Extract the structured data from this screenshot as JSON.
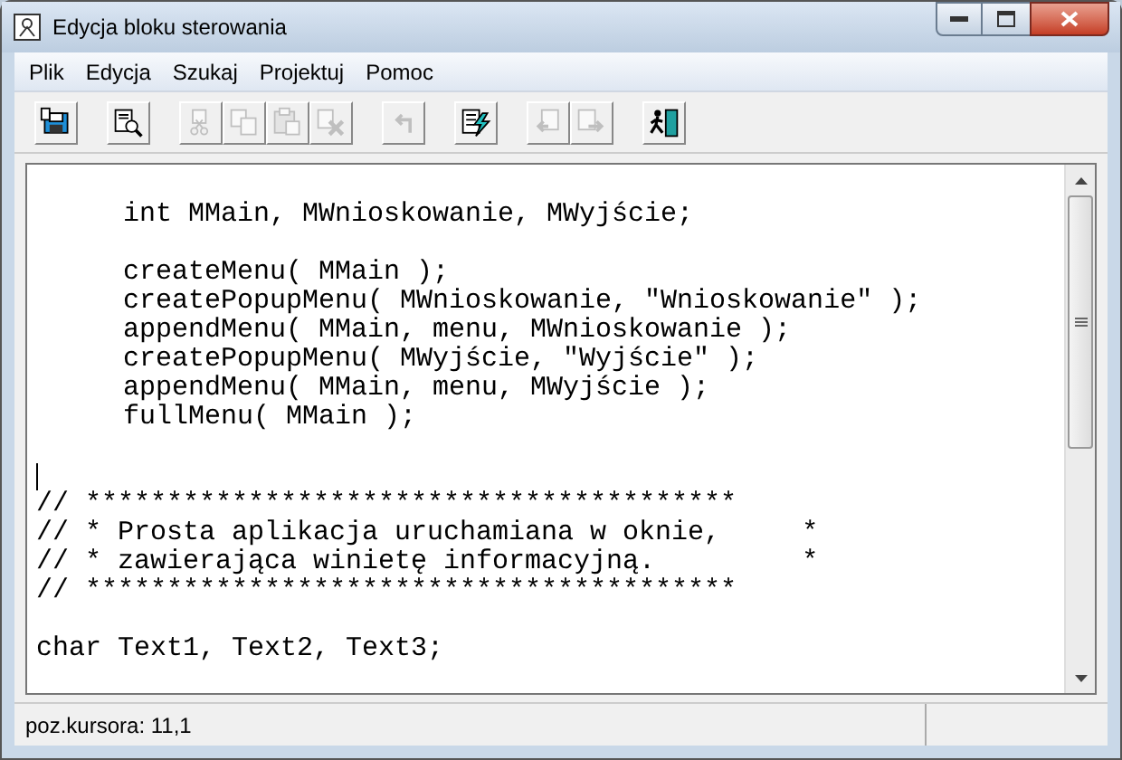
{
  "window": {
    "title": "Edycja bloku sterowania"
  },
  "menu": [
    {
      "label": "Plik"
    },
    {
      "label": "Edycja"
    },
    {
      "label": "Szukaj"
    },
    {
      "label": "Projektuj"
    },
    {
      "label": "Pomoc"
    }
  ],
  "toolbar": [
    {
      "kind": "save",
      "disabled": false,
      "gap": false
    },
    {
      "kind": "preview",
      "disabled": false,
      "gap": true
    },
    {
      "kind": "cut",
      "disabled": true,
      "gap": true
    },
    {
      "kind": "copy",
      "disabled": true,
      "gap": false
    },
    {
      "kind": "paste",
      "disabled": true,
      "gap": false
    },
    {
      "kind": "delete",
      "disabled": true,
      "gap": false
    },
    {
      "kind": "undo",
      "disabled": true,
      "gap": true
    },
    {
      "kind": "compile",
      "disabled": false,
      "gap": true
    },
    {
      "kind": "prev",
      "disabled": true,
      "gap": true
    },
    {
      "kind": "next",
      "disabled": true,
      "gap": false
    },
    {
      "kind": "exit",
      "disabled": false,
      "gap": true
    }
  ],
  "editor": {
    "lines": [
      {
        "kind": "blank"
      },
      {
        "kind": "code",
        "text": "int MMain, MWnioskowanie, MWyjście;",
        "indented": true
      },
      {
        "kind": "blank"
      },
      {
        "kind": "code",
        "text": "createMenu( MMain );",
        "indented": true
      },
      {
        "kind": "code",
        "text": "createPopupMenu( MWnioskowanie, \"Wnioskowanie\" );",
        "indented": true
      },
      {
        "kind": "code",
        "text": "appendMenu( MMain, menu, MWnioskowanie );",
        "indented": true
      },
      {
        "kind": "code",
        "text": "createPopupMenu( MWyjście, \"Wyjście\" );",
        "indented": true
      },
      {
        "kind": "code",
        "text": "appendMenu( MMain, menu, MWyjście );",
        "indented": true
      },
      {
        "kind": "code",
        "text": "fullMenu( MMain );",
        "indented": true
      },
      {
        "kind": "blank"
      },
      {
        "kind": "cursor"
      },
      {
        "kind": "code",
        "text": "// ****************************************",
        "indented": false
      },
      {
        "kind": "code",
        "text": "// * Prosta aplikacja uruchamiana w oknie,     *",
        "indented": false
      },
      {
        "kind": "code",
        "text": "// * zawierająca winietę informacyjną.         *",
        "indented": false
      },
      {
        "kind": "code",
        "text": "// ****************************************",
        "indented": false
      },
      {
        "kind": "blank"
      },
      {
        "kind": "code",
        "text": "char Text1, Text2, Text3;",
        "indented": false
      }
    ]
  },
  "status_bar": {
    "text": "poz.kursora: 11,1"
  }
}
